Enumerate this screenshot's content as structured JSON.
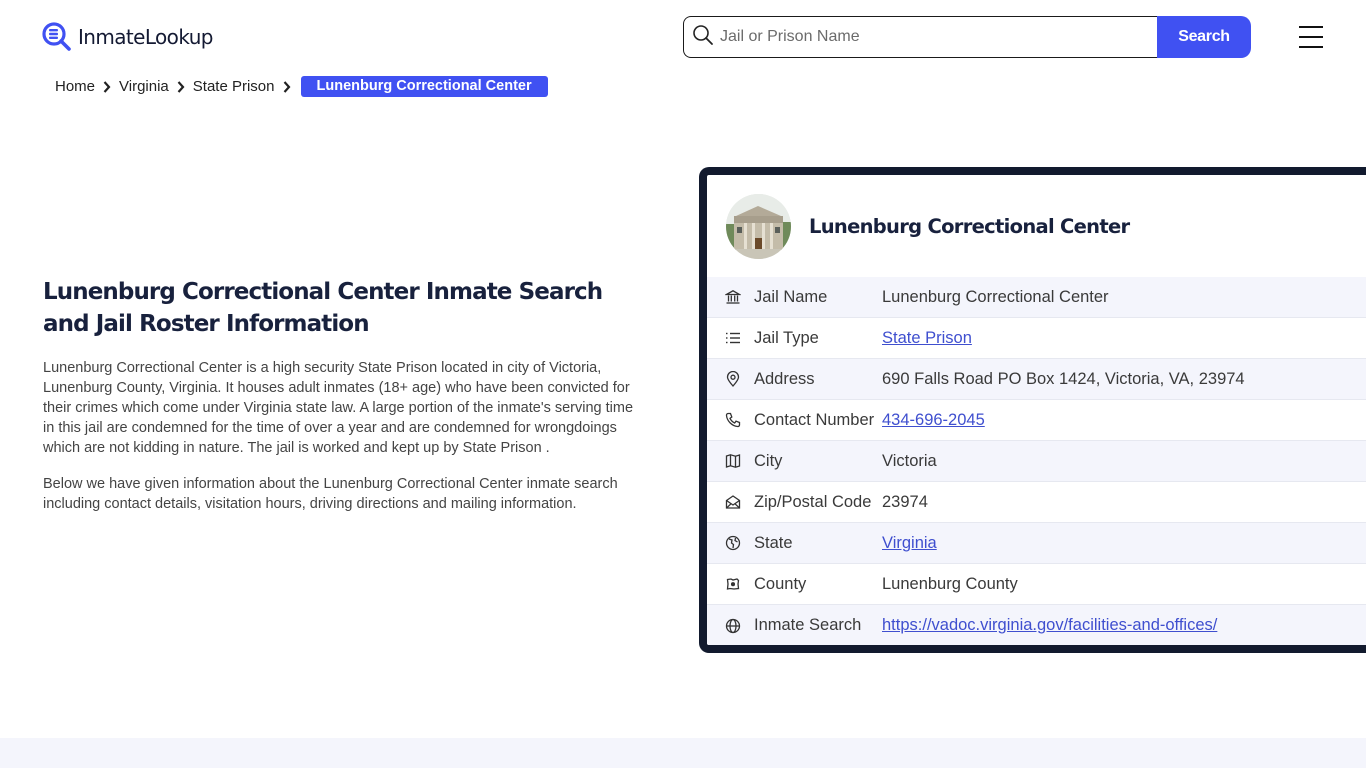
{
  "header": {
    "logo_text": "InmateLookup",
    "search_placeholder": "Jail or Prison Name",
    "search_value": "",
    "search_button": "Search",
    "brand_color": "#4051f2"
  },
  "breadcrumb": {
    "items": [
      "Home",
      "Virginia",
      "State Prison"
    ],
    "active": "Lunenburg Correctional Center"
  },
  "intro": {
    "title": "Lunenburg Correctional Center Inmate Search and Jail Roster Information",
    "paragraphs": [
      "Lunenburg Correctional Center is a high security State Prison located in city of Victoria, Lunenburg County, Virginia. It houses adult inmates (18+ age) who have been convicted for their crimes which come under Virginia state law. A large portion of the inmate's serving time in this jail are condemned for the time of over a year and are condemned for wrongdoings which are not kidding in nature. The jail is worked and kept up by State Prison .",
      "Below we have given information about the Lunenburg Correctional Center inmate search including contact details, visitation hours, driving directions and mailing information."
    ]
  },
  "card": {
    "title": "Lunenburg Correctional Center",
    "image_alt": "building-photo",
    "rows": [
      {
        "icon": "bank-icon",
        "label": "Jail Name",
        "value": "Lunenburg Correctional Center",
        "link": false
      },
      {
        "icon": "list-icon",
        "label": "Jail Type",
        "value": "State Prison",
        "link": true
      },
      {
        "icon": "map-pin-icon",
        "label": "Address",
        "value": "690 Falls Road PO Box 1424, Victoria, VA, 23974",
        "link": false
      },
      {
        "icon": "phone-icon",
        "label": "Contact Number",
        "value": "434-696-2045",
        "link": true
      },
      {
        "icon": "map-icon",
        "label": "City",
        "value": "Victoria",
        "link": false
      },
      {
        "icon": "mail-open-icon",
        "label": "Zip/Postal Code",
        "value": "23974",
        "link": false
      },
      {
        "icon": "globe-region-icon",
        "label": "State",
        "value": "Virginia",
        "link": true
      },
      {
        "icon": "county-map-icon",
        "label": "County",
        "value": "Lunenburg County",
        "link": false
      },
      {
        "icon": "world-icon",
        "label": "Inmate Search",
        "value": "https://vadoc.virginia.gov/facilities-and-offices/",
        "link": true
      }
    ]
  }
}
